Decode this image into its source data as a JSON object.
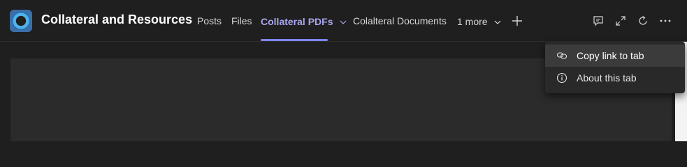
{
  "team": {
    "title": "Collateral and Resources",
    "logo_icon": "team-ring-logo"
  },
  "tabs": [
    {
      "label": "Posts"
    },
    {
      "label": "Files"
    },
    {
      "label": "Collateral PDFs",
      "active": true
    },
    {
      "label": "Colalteral Documents"
    },
    {
      "label": "1 more"
    }
  ],
  "header_icons": [
    "add-tab-icon",
    "conversation-icon",
    "expand-icon",
    "refresh-icon",
    "more-options-icon"
  ],
  "menu": {
    "items": [
      {
        "label": "Copy link to tab",
        "icon": "link-icon"
      },
      {
        "label": "About this tab",
        "icon": "info-icon"
      }
    ]
  },
  "colors": {
    "accent": "#7f85f5",
    "active_tab_text": "#a9a6f0",
    "background": "#1f1f1f",
    "menu_background": "#292929"
  }
}
